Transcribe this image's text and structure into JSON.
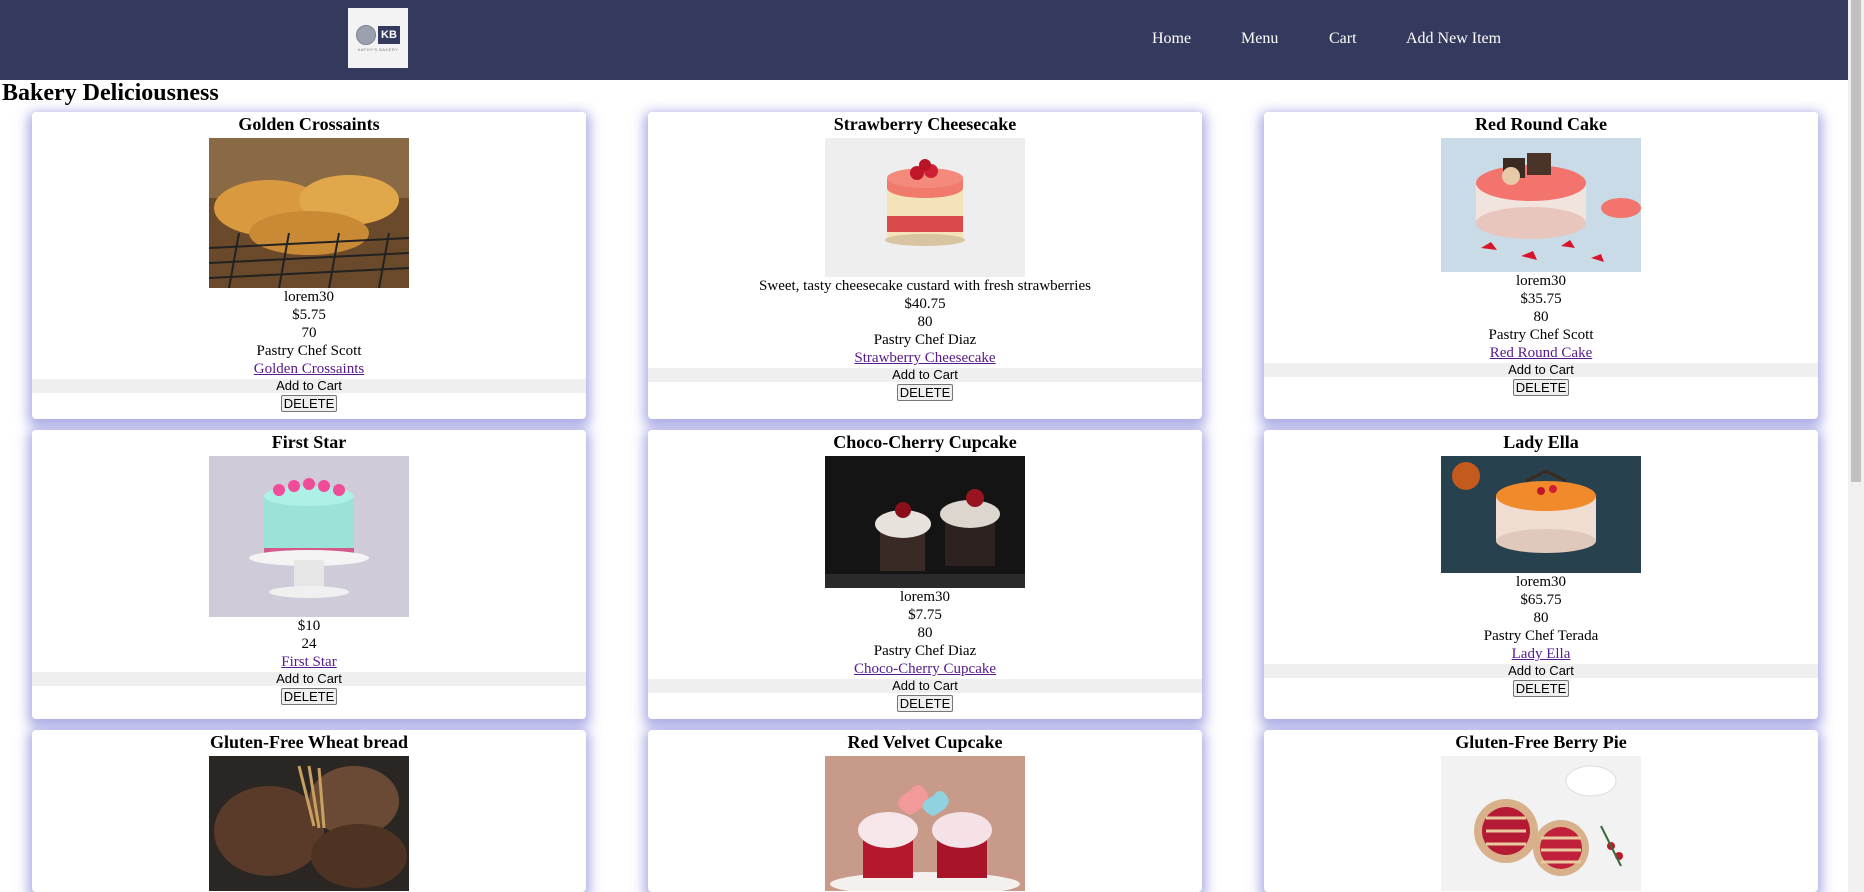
{
  "logo": {
    "letters": "KB",
    "tagline": "KATHY'S BAKERY"
  },
  "nav": [
    {
      "label": "Home"
    },
    {
      "label": "Menu"
    },
    {
      "label": "Cart"
    },
    {
      "label": "Add New Item"
    }
  ],
  "page_title": "Bakery Deliciousness",
  "add_label": "Add to Cart",
  "delete_label": "DELETE",
  "products": [
    {
      "title": "Golden Crossaints",
      "description": "lorem30",
      "price": "$5.75",
      "quantity": "70",
      "chef": "Pastry Chef Scott",
      "link": "Golden Crossaints"
    },
    {
      "title": "Strawberry Cheesecake",
      "description": "Sweet, tasty cheesecake custard with fresh strawberries",
      "price": "$40.75",
      "quantity": "80",
      "chef": "Pastry Chef Diaz",
      "link": "Strawberry Cheesecake"
    },
    {
      "title": "Red Round Cake",
      "description": "lorem30",
      "price": "$35.75",
      "quantity": "80",
      "chef": "Pastry Chef Scott",
      "link": "Red Round Cake"
    },
    {
      "title": "First Star",
      "price": "$10",
      "quantity": "24",
      "link": "First Star"
    },
    {
      "title": "Choco-Cherry Cupcake",
      "description": "lorem30",
      "price": "$7.75",
      "quantity": "80",
      "chef": "Pastry Chef Diaz",
      "link": "Choco-Cherry Cupcake"
    },
    {
      "title": "Lady Ella",
      "description": "lorem30",
      "price": "$65.75",
      "quantity": "80",
      "chef": "Pastry Chef Terada",
      "link": "Lady Ella"
    },
    {
      "title": "Gluten-Free Wheat bread"
    },
    {
      "title": "Red Velvet Cupcake"
    },
    {
      "title": "Gluten-Free Berry Pie"
    }
  ]
}
